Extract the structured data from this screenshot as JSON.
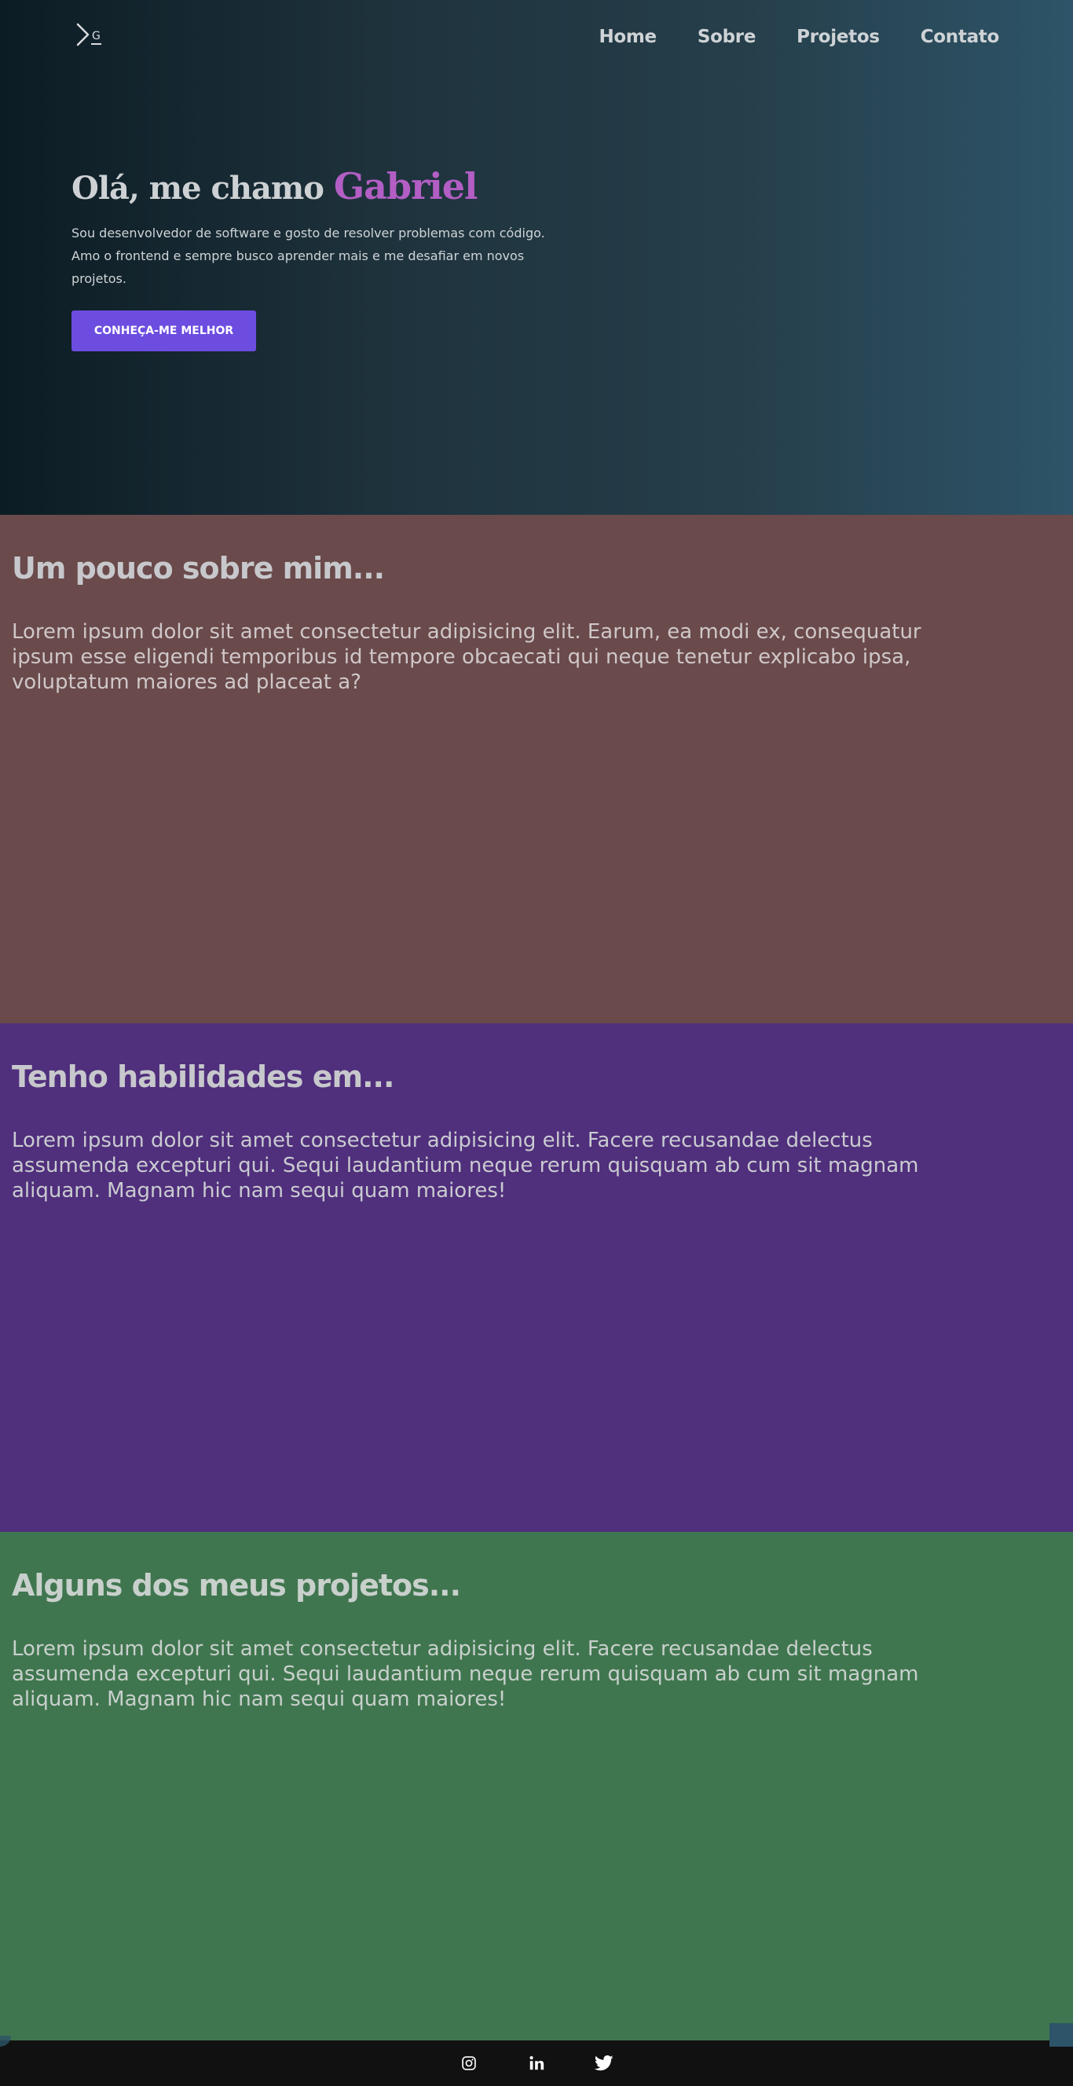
{
  "nav": {
    "logo_letter": "G",
    "links": [
      "Home",
      "Sobre",
      "Projetos",
      "Contato"
    ]
  },
  "hero": {
    "greeting": "Olá, me chamo",
    "name": "Gabriel",
    "description": "Sou desenvolvedor de software e gosto de resolver problemas com código. Amo o frontend e sempre busco aprender mais e me desafiar em novos projetos.",
    "cta_label": "CONHEÇA-ME MELHOR"
  },
  "about": {
    "title": "Um pouco sobre mim...",
    "text": "Lorem ipsum dolor sit amet consectetur adipisicing elit. Earum, ea modi ex, consequatur ipsum esse eligendi temporibus id tempore obcaecati qui neque tenetur explicabo ipsa, voluptatum maiores ad placeat a?"
  },
  "skills": {
    "title": "Tenho habilidades em...",
    "text": "Lorem ipsum dolor sit amet consectetur adipisicing elit. Facere recusandae delectus assumenda excepturi qui. Sequi laudantium neque rerum quisquam ab cum sit magnam aliquam. Magnam hic nam sequi quam maiores!"
  },
  "projects": {
    "title": "Alguns dos meus projetos...",
    "text": "Lorem ipsum dolor sit amet consectetur adipisicing elit. Facere recusandae delectus assumenda excepturi qui. Sequi laudantium neque rerum quisquam ab cum sit magnam aliquam. Magnam hic nam sequi quam maiores!"
  },
  "footer": {
    "icons": [
      "instagram-icon",
      "linkedin-icon",
      "twitter-icon"
    ]
  },
  "colors": {
    "accent": "#6c4de0",
    "name_highlight": "#b25ec4",
    "about_bg": "#6a4a4b",
    "skills_bg": "#502f7c",
    "projects_bg": "#40764f",
    "footer_bg": "#111111"
  }
}
